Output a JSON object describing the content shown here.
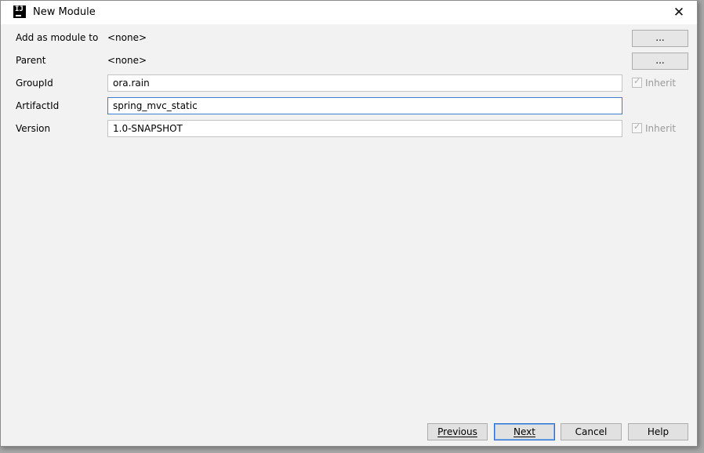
{
  "window": {
    "title": "New Module",
    "icon_label": "IJ",
    "close_glyph": "✕"
  },
  "form": {
    "add_as_module": {
      "label": "Add as module to",
      "value": "<none>",
      "browse_label": "..."
    },
    "parent": {
      "label": "Parent",
      "value": "<none>",
      "browse_label": "..."
    },
    "group_id": {
      "label": "GroupId",
      "value": "ora.rain",
      "inherit_label": "Inherit",
      "inherit_checked": true,
      "inherit_enabled": false
    },
    "artifact_id": {
      "label": "ArtifactId",
      "value": "spring_mvc_static",
      "focused": true
    },
    "version": {
      "label": "Version",
      "value": "1.0-SNAPSHOT",
      "inherit_label": "Inherit",
      "inherit_checked": true,
      "inherit_enabled": false
    }
  },
  "footer": {
    "previous_label": "Previous",
    "next_label": "Next",
    "cancel_label": "Cancel",
    "help_label": "Help"
  },
  "colors": {
    "dialog_bg": "#f2f2f2",
    "focus_border": "#3c7fd1",
    "disabled_text": "#9a9a9a"
  }
}
